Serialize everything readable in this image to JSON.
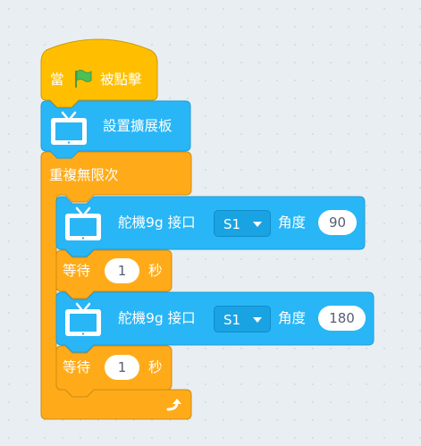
{
  "hat_block": {
    "label_before": "當",
    "label_after": "被點擊",
    "flag_icon": "green-flag-icon"
  },
  "setup_block": {
    "label": "設置擴展板",
    "icon": "tv-board-icon"
  },
  "forever_block": {
    "label": "重複無限次",
    "loop_icon": "loop-arrow-icon"
  },
  "servo_blocks": [
    {
      "label": "舵機9g 接口",
      "port": "S1",
      "angle_label": "角度",
      "angle": "90"
    },
    {
      "label": "舵機9g 接口",
      "port": "S1",
      "angle_label": "角度",
      "angle": "180"
    }
  ],
  "wait_blocks": [
    {
      "label": "等待",
      "value": "1",
      "unit": "秒"
    },
    {
      "label": "等待",
      "value": "1",
      "unit": "秒"
    }
  ],
  "colors": {
    "events": "#ffbf00",
    "control": "#ffab19",
    "extension": "#29b6f6",
    "flag": "#4cbf56"
  }
}
